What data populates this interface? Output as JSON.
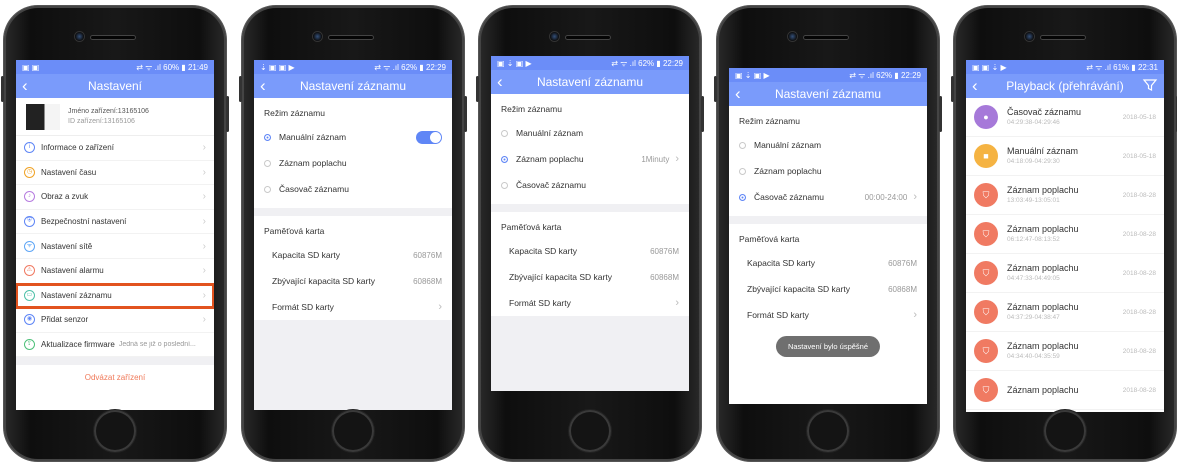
{
  "colors": {
    "accent": "#7a9bfb",
    "highlight": "#e2531f",
    "purple": "#a679d9",
    "orange": "#f5b342",
    "salmon": "#f07a62"
  },
  "screen1": {
    "status": {
      "left": "▣ ▣",
      "right": "⇄ ᯤ .ıl 60% ▮ 21:49"
    },
    "title": "Nastavení",
    "device_name": "Jméno zařízení:13165106",
    "device_id": "ID zařízení:13165106",
    "menu": [
      {
        "label": "Informace o zařízení",
        "icon": "info-icon",
        "glyph": "i",
        "color": "#5f86f6"
      },
      {
        "label": "Nastavení času",
        "icon": "clock-icon",
        "glyph": "◷",
        "color": "#f0a326"
      },
      {
        "label": "Obraz a zvuk",
        "icon": "media-icon",
        "glyph": "♪",
        "color": "#b67ce0"
      },
      {
        "label": "Bezpečnostní nastavení",
        "icon": "shield-icon",
        "glyph": "⛨",
        "color": "#5f86f6"
      },
      {
        "label": "Nastavení sítě",
        "icon": "wifi-icon",
        "glyph": "ᯤ",
        "color": "#5fa6f6"
      },
      {
        "label": "Nastavení alarmu",
        "icon": "alarm-icon",
        "glyph": "⚠",
        "color": "#f07a62"
      },
      {
        "label": "Nastavení záznamu",
        "icon": "video-icon",
        "glyph": "▭",
        "color": "#4ec0a8"
      },
      {
        "label": "Přidat senzor",
        "icon": "sensor-icon",
        "glyph": "◉",
        "color": "#5f86f6"
      },
      {
        "label": "Aktualizace firmware",
        "icon": "firmware-icon",
        "glyph": "⇪",
        "color": "#4ec07a",
        "extra": "Jedná se již o poslední..."
      }
    ],
    "unbind": "Odvázat zařízení"
  },
  "screen2": {
    "status": {
      "left": "⇣ ▣ ▣ ▶",
      "right": "⇄ ᯤ .ıl 62% ▮ 22:29"
    },
    "title": "Nastavení záznamu",
    "mode_head": "Režim záznamu",
    "modes": [
      "Manuální záznam",
      "Záznam poplachu",
      "Časovač záznamu"
    ],
    "card_head": "Paměťová karta",
    "capacity_label": "Kapacita SD karty",
    "capacity": "60876M",
    "remaining_label": "Zbývající kapacita SD karty",
    "remaining": "60868M",
    "format_label": "Formát SD karty"
  },
  "screen3": {
    "status": {
      "left": "▣ ⇣ ▣ ▶",
      "right": "⇄ ᯤ .ıl 62% ▮ 22:29"
    },
    "title": "Nastavení záznamu",
    "mode_head": "Režim záznamu",
    "modes": [
      "Manuální záznam",
      "Záznam poplachu",
      "Časovač záznamu"
    ],
    "alarm_value": "1Minuty",
    "card_head": "Paměťová karta",
    "capacity_label": "Kapacita SD karty",
    "capacity": "60876M",
    "remaining_label": "Zbývající kapacita SD karty",
    "remaining": "60868M",
    "format_label": "Formát SD karty"
  },
  "screen4": {
    "status": {
      "left": "▣ ⇣ ▣ ▶",
      "right": "⇄ ᯤ .ıl 62% ▮ 22:29"
    },
    "title": "Nastavení záznamu",
    "mode_head": "Režim záznamu",
    "modes": [
      "Manuální záznam",
      "Záznam poplachu",
      "Časovač záznamu"
    ],
    "timer_value": "00:00-24:00",
    "card_head": "Paměťová karta",
    "capacity_label": "Kapacita SD karty",
    "capacity": "60876M",
    "remaining_label": "Zbývající kapacita SD karty",
    "remaining": "60868M",
    "format_label": "Formát SD karty",
    "toast": "Nastavení bylo úspěšné"
  },
  "screen5": {
    "status": {
      "left": "▣ ▣ ⇣ ▶",
      "right": "⇄ ᯤ .ıl 61% ▮ 22:31"
    },
    "title": "Playback (přehrávání)",
    "items": [
      {
        "name": "Časovač záznamu",
        "time": "04:29:38-04:29:46",
        "date": "2018-05-18",
        "icon": "timer-icon",
        "glyph": "●",
        "color": "#a679d9"
      },
      {
        "name": "Manuální záznam",
        "time": "04:18:09-04:29:30",
        "date": "2018-05-18",
        "icon": "camera-icon",
        "glyph": "■",
        "color": "#f5b342"
      },
      {
        "name": "Záznam poplachu",
        "time": "13:03:49-13:05:01",
        "date": "2018-08-28",
        "icon": "alarm-shield-icon",
        "glyph": "⛉",
        "color": "#f07a62"
      },
      {
        "name": "Záznam poplachu",
        "time": "06:12:47-08:13:52",
        "date": "2018-08-28",
        "icon": "alarm-shield-icon",
        "glyph": "⛉",
        "color": "#f07a62"
      },
      {
        "name": "Záznam poplachu",
        "time": "04:47:33-04:49:05",
        "date": "2018-08-28",
        "icon": "alarm-shield-icon",
        "glyph": "⛉",
        "color": "#f07a62"
      },
      {
        "name": "Záznam poplachu",
        "time": "04:37:29-04:38:47",
        "date": "2018-08-28",
        "icon": "alarm-shield-icon",
        "glyph": "⛉",
        "color": "#f07a62"
      },
      {
        "name": "Záznam poplachu",
        "time": "04:34:40-04:35:59",
        "date": "2018-08-28",
        "icon": "alarm-shield-icon",
        "glyph": "⛉",
        "color": "#f07a62"
      },
      {
        "name": "Záznam poplachu",
        "time": "",
        "date": "2018-08-28",
        "icon": "alarm-shield-icon",
        "glyph": "⛉",
        "color": "#f07a62"
      }
    ]
  }
}
